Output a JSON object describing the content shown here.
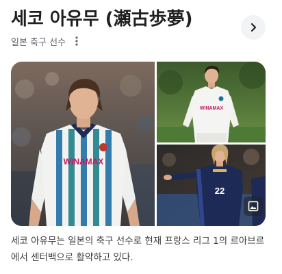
{
  "header": {
    "title": "세코 아유무 (瀬古歩夢)",
    "subtitle": "일본 축구 선수",
    "next_icon": "chevron-right-icon",
    "more_icon": "more-vertical-icon"
  },
  "gallery": {
    "main_jersey_sponsor": "WINAMAX",
    "top_right_jersey_sponsor": "WINAMAX",
    "bottom_right_jersey_number": "22",
    "badge_icon": "image-gallery-icon",
    "colors": {
      "club_blue": "#1f6fa3",
      "club_teal": "#1d7f88",
      "national_navy": "#1d2a55"
    }
  },
  "description": "세코 아유무는 일본의 축구 선수로 현재 프랑스 리그 1의 르아브르에서 센터백으로 활약하고 있다."
}
